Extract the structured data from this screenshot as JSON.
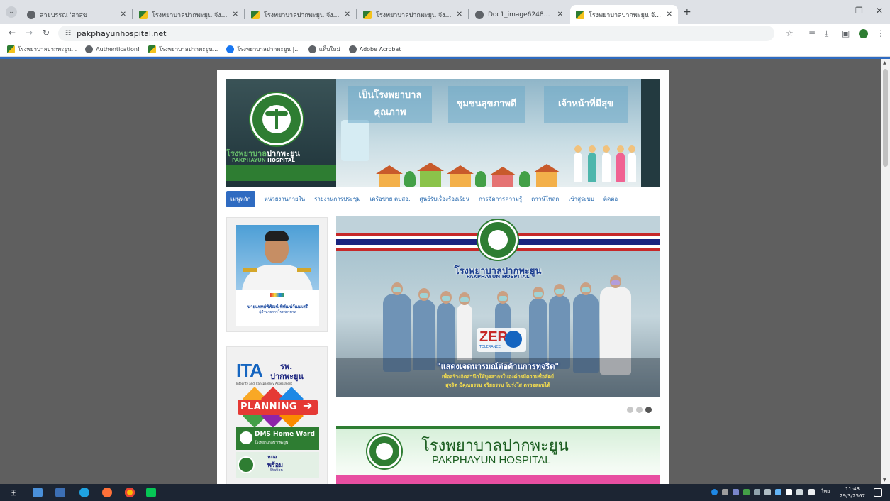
{
  "browser": {
    "tabs": [
      {
        "title": "สายบรรณ 'สาสุข",
        "icon": "globe-icon",
        "active": false
      },
      {
        "title": "โรงพยาบาลปากพะยูน จังหวัดพัทลุง",
        "icon": "moph-favicon",
        "active": false
      },
      {
        "title": "โรงพยาบาลปากพะยูน จังหวัดพัทลุง",
        "icon": "moph-favicon",
        "active": false
      },
      {
        "title": "โรงพยาบาลปากพะยูน จังหวัดพัทลุง",
        "icon": "moph-favicon",
        "active": false
      },
      {
        "title": "Doc1_image6248_merged.pdf",
        "icon": "globe-icon",
        "active": false
      },
      {
        "title": "โรงพยาบาลปากพะยูน จังหวัดพัทลุง",
        "icon": "moph-favicon",
        "active": true
      }
    ],
    "url": "pakphayunhospital.net",
    "bookmarks": [
      {
        "label": "โรงพยาบาลปากพะยูน...",
        "icon": "moph-favicon"
      },
      {
        "label": "Authentication!",
        "icon": "globe-icon"
      },
      {
        "label": "โรงพยาบาลปากพะยูน...",
        "icon": "moph-favicon"
      },
      {
        "label": "โรงพยาบาลปากพะยูน |...",
        "icon": "facebook-icon"
      },
      {
        "label": "แท็บใหม่",
        "icon": "globe-icon"
      },
      {
        "label": "Adobe Acrobat",
        "icon": "globe-icon"
      }
    ]
  },
  "banner": {
    "hospital_name_th_part1": "โรงพยาบาล",
    "hospital_name_th_part2": "ปากพะยูน",
    "hospital_name_en_part1": "PAKPHAYUN",
    "hospital_name_en_part2": "HOSPITAL",
    "slogans": [
      "เป็นโรงพยาบาลคุณภาพ",
      "ชุมชนสุขภาพดี",
      "เจ้าหน้าที่มีสุข"
    ]
  },
  "menu": {
    "items": [
      {
        "label": "เมนูหลัก",
        "active": true
      },
      {
        "label": "หน่วยงานภายใน",
        "active": false
      },
      {
        "label": "รายงานการประชุม",
        "active": false
      },
      {
        "label": "เครือข่าย คปสอ.",
        "active": false
      },
      {
        "label": "ศูนย์รับเรื่องร้องเรียน",
        "active": false
      },
      {
        "label": "การจัดการความรู้",
        "active": false
      },
      {
        "label": "ดาวน์โหลด",
        "active": false
      },
      {
        "label": "เข้าสู่ระบบ",
        "active": false
      },
      {
        "label": "ติดต่อ",
        "active": false
      }
    ]
  },
  "sidebar": {
    "director_name": "นายแพทย์พิพัฒน์ พิพัฒน์วัฒนเสรี",
    "director_title": "ผู้อำนวยการโรงพยาบาล",
    "ita_big": "ITA",
    "ita_line1": "รพ.",
    "ita_line2": "ปากพะยูน",
    "ita_small": "Integrity and Transparency Assessment",
    "planning": "PLANNING",
    "dms_title": "DMS Home Ward",
    "dms_sub": "โรงพยาบาลปากพะยูน",
    "mor_line1": "หมอ",
    "mor_line2": "พร้อม",
    "mor_line3": "Station"
  },
  "carousel": {
    "hospital_name_th": "โรงพยาบาลปากพะยูน",
    "hospital_name_en": "PAKPHAYUN HOSPITAL",
    "zero_word": "ZERO",
    "zero_small": "TOLERANCE",
    "caption_main": "\"แสดงเจตนารมณ์ต่อต้านการทุจริต\"",
    "caption_line2": "เพื่อสร้างจิตสำนึกให้บุคลากรในองค์กรมีความซื่อสัตย์",
    "caption_line3": "สุจริต มีคุณธรรม จริยธรรม โปร่งใส ตรวจสอบได้",
    "slide_count": 3,
    "active_slide": 3
  },
  "banner2": {
    "title_th": "โรงพยาบาลปากพะยูน",
    "title_en": "PAKPHAYUN HOSPITAL"
  },
  "taskbar": {
    "time": "11:43",
    "date": "29/3/2567",
    "language": "ไทย"
  },
  "colors": {
    "accent": "#2f6bc1",
    "moph_green": "#2e7d32",
    "menu_link": "#2b6cb0"
  }
}
